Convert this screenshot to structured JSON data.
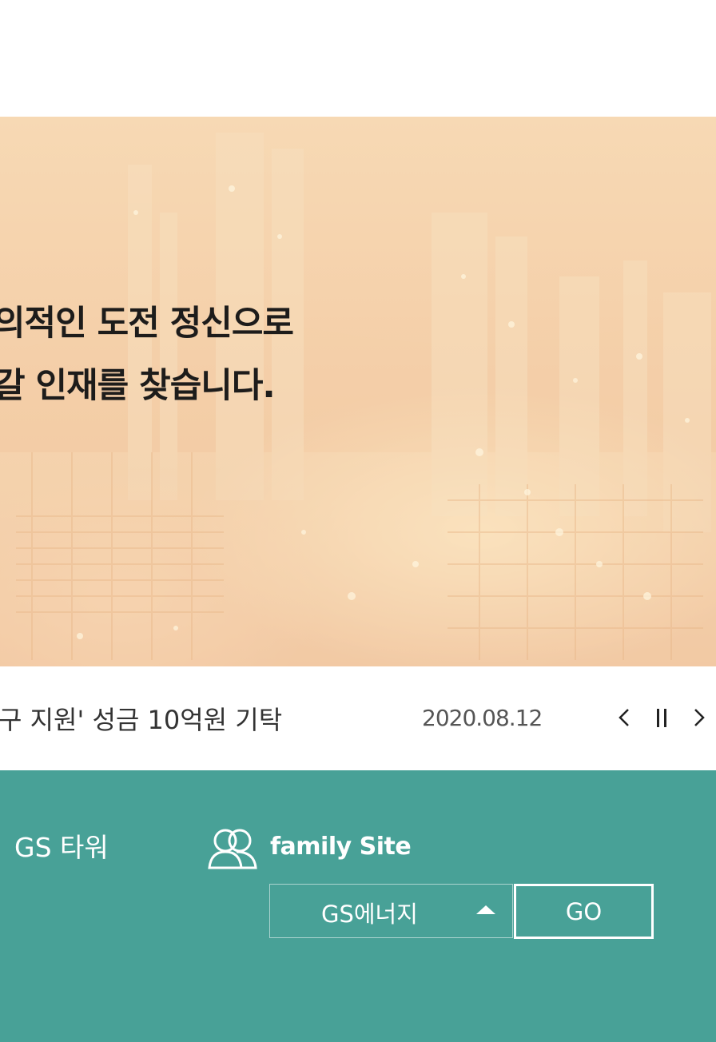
{
  "hero": {
    "line1": "의적인 도전 정신으로",
    "line2": "갈 인재를 찾습니다."
  },
  "news": {
    "title": "구 지원' 성금 10억원 기탁",
    "date": "2020.08.12",
    "prev_label": "‹",
    "pause_label": "II",
    "next_label": "›"
  },
  "footer": {
    "gs_tower": "GS 타워",
    "family_site_label": "family Site",
    "family_select_value": "GS에너지",
    "go_label": "GO"
  },
  "colors": {
    "footer_bg": "#48a197",
    "hero_text": "#1d1c1b"
  },
  "icons": {
    "family": "people-icon",
    "select_caret": "caret-up-icon"
  }
}
